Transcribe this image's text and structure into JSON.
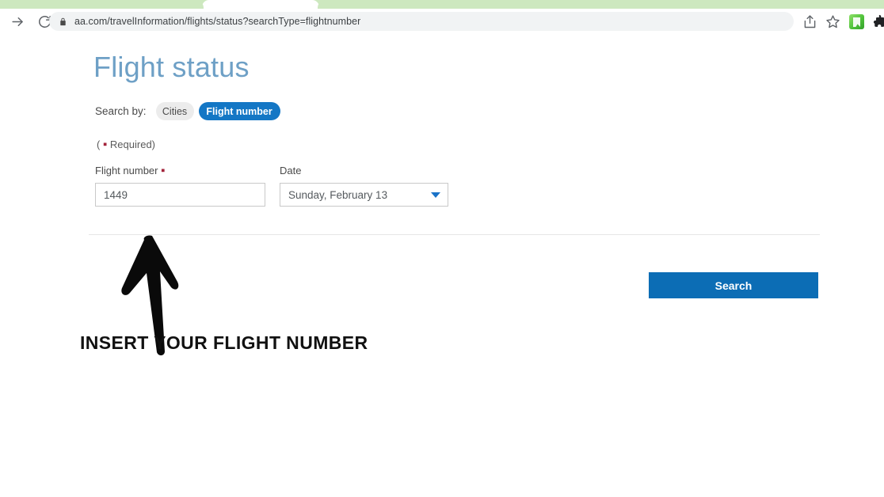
{
  "browser": {
    "url": "aa.com/travelInformation/flights/status?searchType=flightnumber",
    "forward_icon": "forward-arrow-icon",
    "reload_icon": "reload-icon",
    "lock_icon": "lock-icon",
    "share_icon": "share-icon",
    "bookmark_icon": "star-icon",
    "extension_green_icon": "extension-icon",
    "extension_dark_icon": "puzzle-extension-icon",
    "tab_strip_color": "#cde8bf",
    "active_tab_color": "#ffffff"
  },
  "page": {
    "title": "Flight status",
    "title_color": "#6ea0c6",
    "search_by": {
      "label": "Search by:",
      "options": [
        {
          "label": "Cities",
          "active": false
        },
        {
          "label": "Flight number",
          "active": true
        }
      ],
      "active_color": "#1477c5",
      "inactive_color": "#ececec"
    },
    "required_note": {
      "open_paren": "(",
      "dot": "▪",
      "text": " Required)",
      "dot_color": "#a3243b"
    },
    "fields": {
      "flight_number": {
        "label": "Flight number",
        "required_marker": "▪",
        "value": "1449"
      },
      "date": {
        "label": "Date",
        "value": "Sunday, February 13",
        "chevron_icon": "chevron-down-icon",
        "chevron_color": "#1a73c8"
      }
    },
    "search_button": {
      "label": "Search",
      "color": "#0c6db5"
    }
  },
  "annotation": {
    "text": "INSERT YOUR FLIGHT NUMBER",
    "arrow_icon": "hand-drawn-arrow-icon",
    "color": "#111111"
  }
}
